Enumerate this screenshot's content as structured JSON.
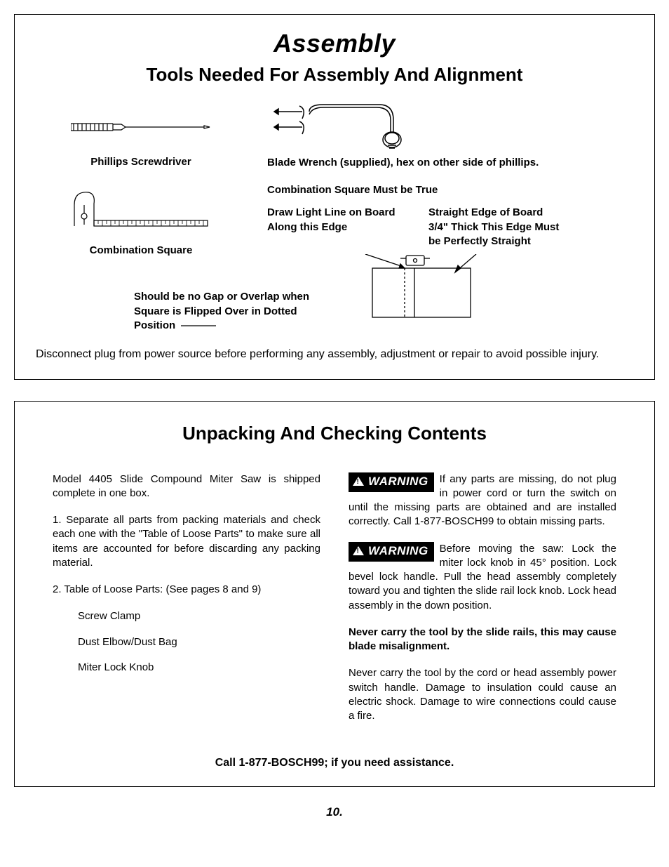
{
  "section1": {
    "title": "Assembly",
    "subtitle": "Tools Needed For Assembly And Alignment",
    "tool1_label": "Phillips Screwdriver",
    "tool2_label": "Blade Wrench (supplied), hex on other side of phillips.",
    "tool3_label": "Combination Square",
    "square_heading": "Combination Square Must be True",
    "square_col1": "Draw Light Line on Board Along this Edge",
    "square_col2": "Straight Edge of Board 3/4\" Thick This Edge Must be Perfectly Straight",
    "square_note": "Should be no Gap or Overlap when Square is Flipped Over in Dotted Position",
    "disconnect": "Disconnect plug from power source before performing any assembly, adjustment or repair to avoid possible injury."
  },
  "section2": {
    "subtitle": "Unpacking And Checking Contents",
    "left": {
      "p1": "Model 4405 Slide Compound Miter Saw is shipped complete in one box.",
      "p2": "1.   Separate all parts from packing materials and check each one with the \"Table of Loose Parts\" to make sure all items are accounted for before discarding any packing material.",
      "p3": "2.   Table of Loose Parts: (See pages 8 and 9)",
      "li1": "Screw Clamp",
      "li2": "Dust Elbow/Dust Bag",
      "li3": "Miter Lock Knob"
    },
    "right": {
      "warning_label": "WARNING",
      "w1": "If any parts are missing, do not plug in power cord or turn the switch on until the missing parts are obtained and are installed correctly. Call 1-877-BOSCH99 to obtain missing parts.",
      "w2": "Before moving the saw:  Lock the miter lock knob in 45° position. Lock bevel lock handle. Pull the head assembly completely toward you and tighten the slide rail lock knob. Lock head assembly in the down position.",
      "bold": "Never carry the tool by the slide rails, this may cause blade misalignment.",
      "p4": "Never carry the tool by the cord or head assembly power switch handle. Damage to insulation could cause an electric shock. Damage to wire connections could cause a fire."
    },
    "assist": "Call 1-877-BOSCH99; if you need assistance."
  },
  "page_number": "10."
}
